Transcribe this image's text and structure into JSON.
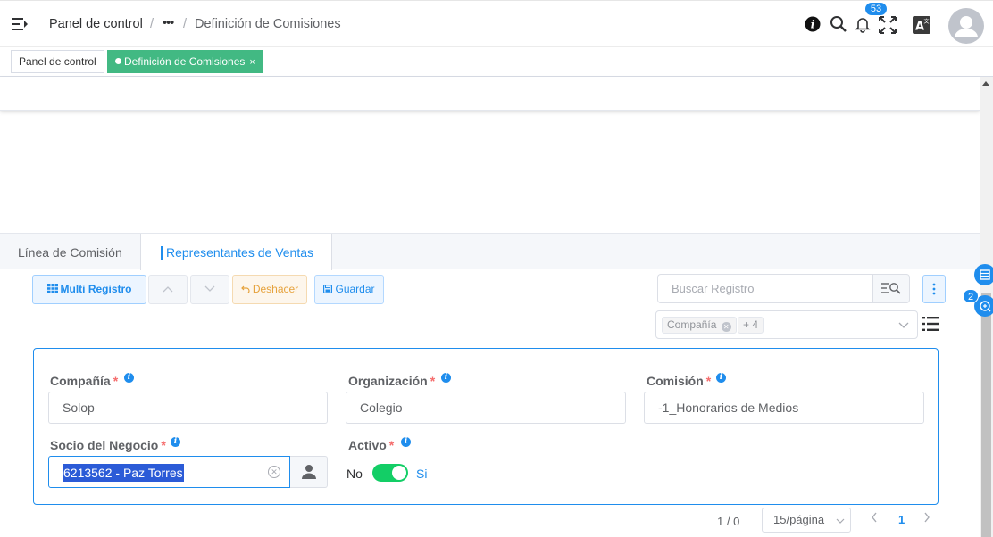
{
  "header": {
    "breadcrumb": [
      "Panel de control",
      "•••",
      "Definición de Comisiones"
    ],
    "separator": "/",
    "notification_count": "53"
  },
  "tags": {
    "items": [
      {
        "label": "Panel de control",
        "active": false
      },
      {
        "label": "Definición de Comisiones",
        "active": true,
        "close": "×"
      }
    ]
  },
  "tabs": {
    "items": [
      {
        "label": "Línea de Comisión"
      },
      {
        "label": "Representantes de Ventas"
      }
    ]
  },
  "toolbar": {
    "multi_label": "Multi Registro",
    "undo_label": "Deshacer",
    "save_label": "Guardar",
    "search_placeholder": "Buscar Registro",
    "filter_chip": "Compañía",
    "filter_more": "+ 4",
    "side_badge": "2"
  },
  "form": {
    "compania_label": "Compañía",
    "compania_value": "Solop",
    "organizacion_label": "Organización",
    "organizacion_value": "Colegio",
    "comision_label": "Comisión",
    "comision_value": "-1_Honorarios de Medios",
    "socio_label": "Socio del Negocio",
    "socio_value": "6213562 - Paz Torres",
    "activo_label": "Activo",
    "activo_no": "No",
    "activo_si": "Si",
    "required_mark": "*",
    "activo_on": true
  },
  "pagination": {
    "count": "1 / 0",
    "page_size": "15/página",
    "current_page": "1"
  },
  "colors": {
    "primary": "#1f8ded",
    "tag_active": "#42b983",
    "switch_on": "#13ce66",
    "required": "#f56c6c"
  }
}
